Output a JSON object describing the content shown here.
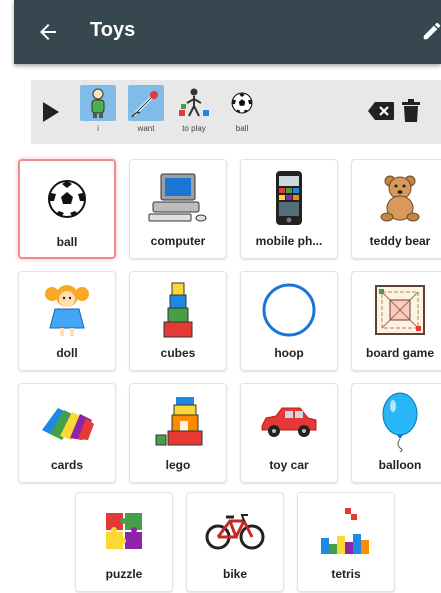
{
  "header": {
    "title": "Toys"
  },
  "sentence": {
    "words": [
      {
        "label": "i",
        "icon": "person-i-icon"
      },
      {
        "label": "want",
        "icon": "want-hand-icon"
      },
      {
        "label": "to play",
        "icon": "to-play-icon"
      },
      {
        "label": "ball",
        "icon": "soccer-ball-icon"
      }
    ]
  },
  "tiles": [
    {
      "label": "ball",
      "icon": "soccer-ball-icon"
    },
    {
      "label": "computer",
      "icon": "computer-icon"
    },
    {
      "label": "mobile ph...",
      "icon": "mobile-phone-icon"
    },
    {
      "label": "teddy bear",
      "icon": "teddy-bear-icon"
    },
    {
      "label": "doll",
      "icon": "doll-icon"
    },
    {
      "label": "cubes",
      "icon": "cubes-icon"
    },
    {
      "label": "hoop",
      "icon": "hoop-icon"
    },
    {
      "label": "board game",
      "icon": "board-game-icon"
    },
    {
      "label": "cards",
      "icon": "cards-icon"
    },
    {
      "label": "lego",
      "icon": "lego-icon"
    },
    {
      "label": "toy car",
      "icon": "toy-car-icon"
    },
    {
      "label": "balloon",
      "icon": "balloon-icon"
    },
    {
      "label": "puzzle",
      "icon": "puzzle-icon"
    },
    {
      "label": "bike",
      "icon": "bike-icon"
    },
    {
      "label": "tetris",
      "icon": "tetris-icon"
    }
  ],
  "colors": {
    "appbar": "#37474f",
    "sentence_bar": "#e8e8e8",
    "selected_border": "#f28b8b",
    "word_highlight": "#7fbde8"
  }
}
